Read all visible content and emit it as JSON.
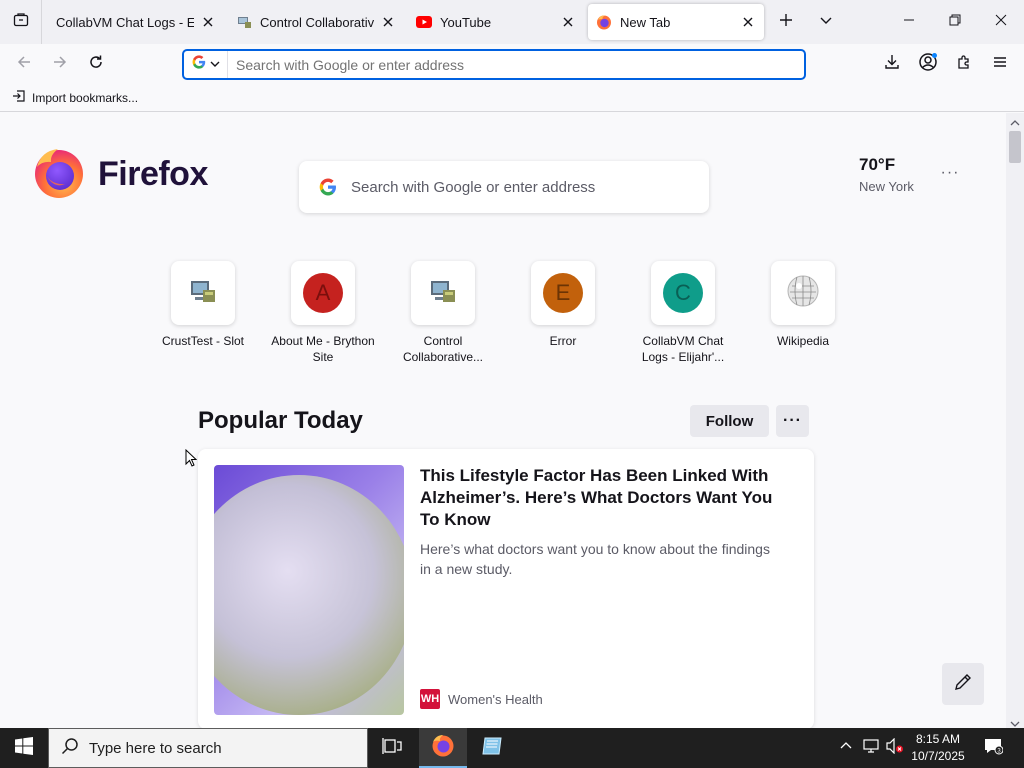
{
  "tabs": [
    {
      "title": "CollabVM Chat Logs - Elijah",
      "favicon": "collabvm-icon"
    },
    {
      "title": "Control Collaborative V",
      "favicon": "computer-icon"
    },
    {
      "title": "YouTube",
      "favicon": "youtube-icon"
    },
    {
      "title": "New Tab",
      "favicon": "firefox-icon"
    }
  ],
  "urlbar": {
    "placeholder": "Search with Google or enter address",
    "value": ""
  },
  "bookmarks": {
    "import_label": "Import bookmarks..."
  },
  "newtab": {
    "wordmark": "Firefox",
    "search_placeholder": "Search with Google or enter address",
    "weather": {
      "temp": "70°F",
      "location": "New York"
    },
    "shortcuts": [
      {
        "label": "CrustTest - Slot",
        "type": "image",
        "icon": "computer-icon"
      },
      {
        "label": "About Me - Brython Site",
        "type": "letter",
        "letter": "A",
        "color": "#c5221f",
        "text_color": "#7a0f0d"
      },
      {
        "label": "Control Collaborative...",
        "type": "image",
        "icon": "computer-icon"
      },
      {
        "label": "Error",
        "type": "letter",
        "letter": "E",
        "color": "#c2610c",
        "text_color": "#6b3405"
      },
      {
        "label": "CollabVM Chat Logs - Elijahr'...",
        "type": "letter",
        "letter": "C",
        "color": "#0f9d8a",
        "text_color": "#0a5f54"
      },
      {
        "label": "Wikipedia",
        "type": "image",
        "icon": "wikipedia-icon"
      }
    ],
    "section_title": "Popular Today",
    "follow_label": "Follow",
    "clipped_heading": "Po",
    "story": {
      "title": "This Lifestyle Factor Has Been Linked With Alzheimer’s. Here’s What Doctors Want You To Know",
      "excerpt": "Here’s what doctors want you to know about the findings in a new study.",
      "source": "Women's Health",
      "source_logo": "WH"
    }
  },
  "taskbar": {
    "search_placeholder": "Type here to search",
    "time": "8:15 AM",
    "date": "10/7/2025"
  },
  "colors": {
    "accent": "#0061e0",
    "firefox_purple": "#20123a"
  }
}
